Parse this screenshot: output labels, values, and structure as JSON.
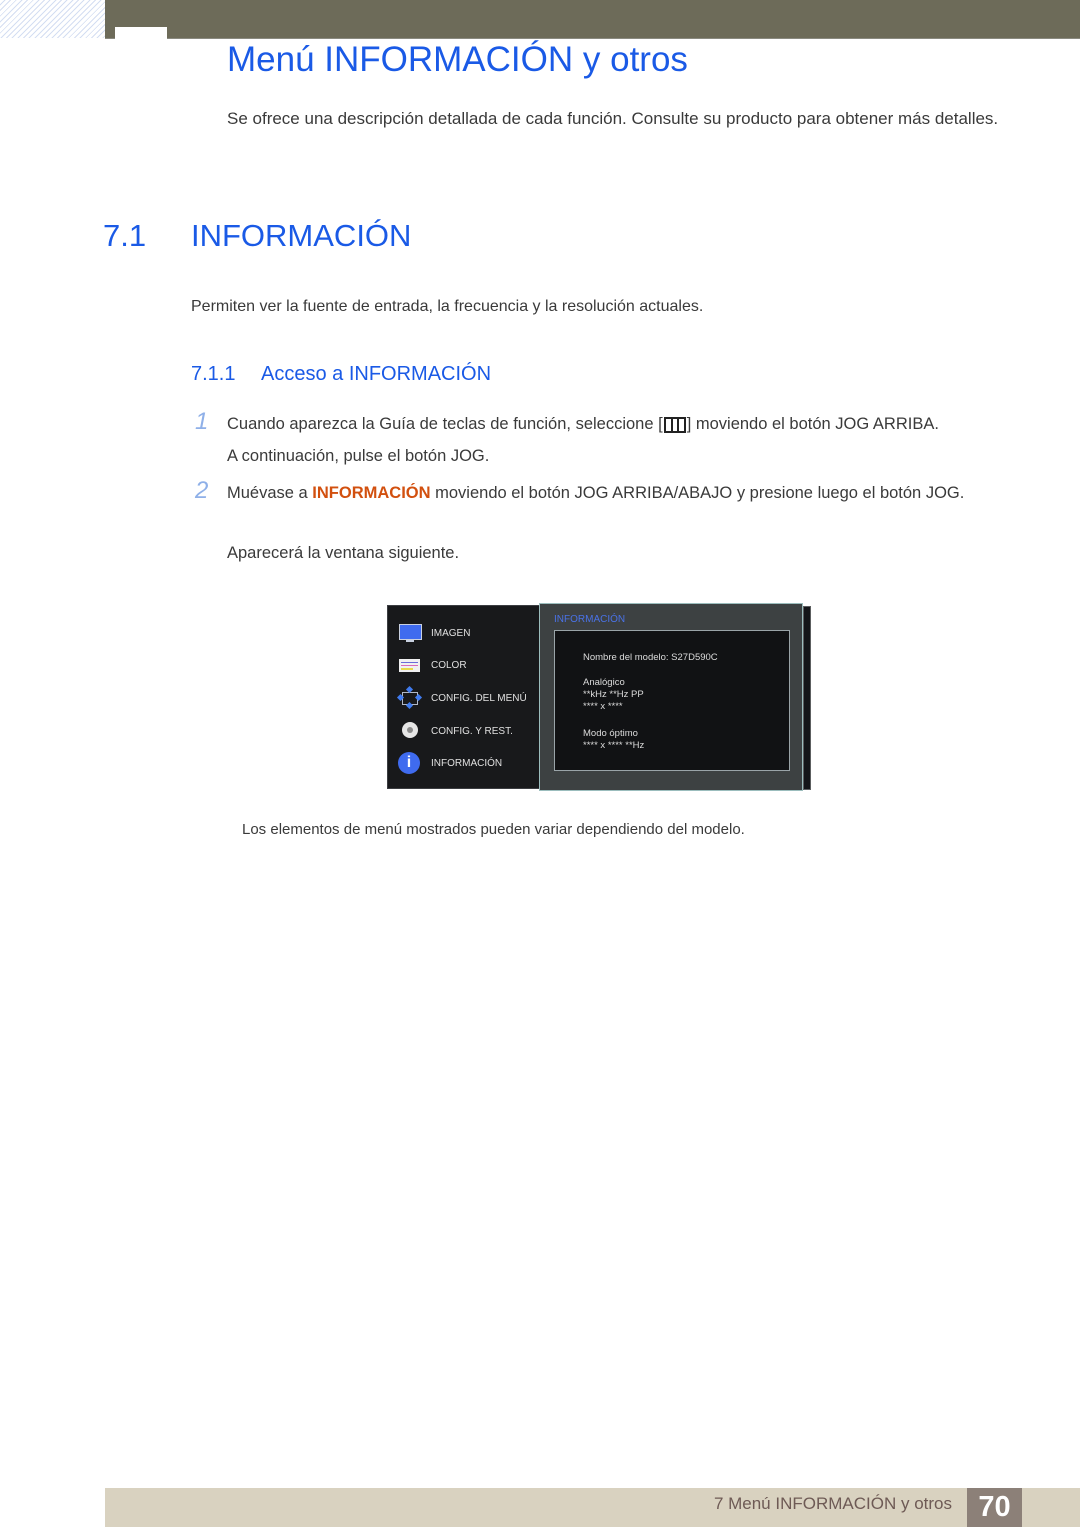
{
  "chapter": {
    "title": "Menú INFORMACIÓN y otros",
    "intro": "Se ofrece una descripción detallada de cada función. Consulte su producto para obtener más detalles."
  },
  "section": {
    "number": "7.1",
    "title": "INFORMACIÓN",
    "description": "Permiten ver la fuente de entrada, la frecuencia y la resolución actuales."
  },
  "subsection": {
    "number": "7.1.1",
    "title": "Acceso a INFORMACIÓN"
  },
  "steps": [
    {
      "number": "1",
      "line1_before": "Cuando aparezca la Guía de teclas de función, seleccione [",
      "line1_after": "] moviendo el botón JOG ARRIBA.",
      "line2": "A continuación, pulse el botón JOG."
    },
    {
      "number": "2",
      "before": "Muévase a ",
      "highlight": "INFORMACIÓN",
      "after": " moviendo el botón JOG ARRIBA/ABAJO y presione luego el botón JOG.",
      "note": "Aparecerá la ventana siguiente."
    }
  ],
  "osd": {
    "menu_items": [
      {
        "label": "IMAGEN",
        "icon": "monitor-icon"
      },
      {
        "label": "COLOR",
        "icon": "color-bars-icon"
      },
      {
        "label": "CONFIG. DEL MENÚ",
        "icon": "menu-settings-arrows-icon"
      },
      {
        "label": "CONFIG. Y REST.",
        "icon": "gear-icon"
      },
      {
        "label": "INFORMACIÓN",
        "icon": "info-icon"
      }
    ],
    "panel_title": "INFORMACIÓN",
    "model_line": "Nombre del modelo: S27D590C",
    "signal": "Analógico",
    "frequency": "**kHz **Hz PP",
    "resolution": "**** x ****",
    "optimal_label": "Modo óptimo",
    "optimal_value": "**** x **** **Hz",
    "colors": {
      "accent": "#4a72e6",
      "panel_bg": "#3d4142",
      "menu_bg": "#18191b"
    }
  },
  "caption": "Los elementos de menú mostrados pueden variar dependiendo del modelo.",
  "footer": {
    "chapter_label": "7 Menú INFORMACIÓN y otros",
    "page_number": "70"
  },
  "colors": {
    "heading_blue": "#1a5ae6",
    "highlight_orange": "#d2500f",
    "topbar": "#6d6b59",
    "footer_bg": "#d9d2c0",
    "page_badge": "#8c8078"
  }
}
